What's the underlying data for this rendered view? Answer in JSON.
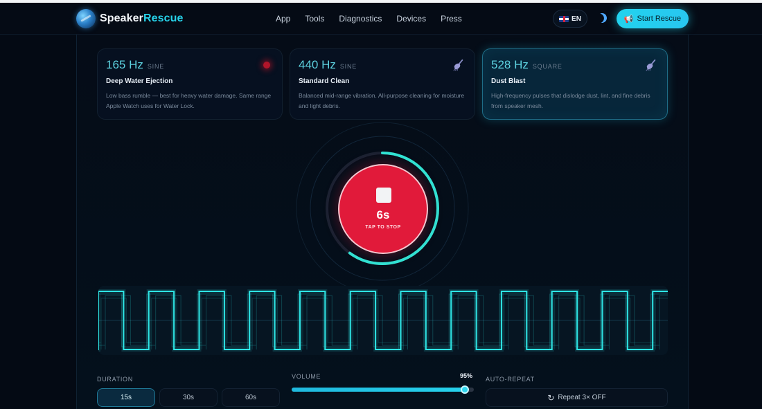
{
  "brand": {
    "name_part1": "Speaker",
    "name_part2": "Rescue"
  },
  "nav": {
    "links": [
      "App",
      "Tools",
      "Diagnostics",
      "Devices",
      "Press"
    ],
    "language": "EN",
    "cta_label": "Start Rescue"
  },
  "modes": [
    {
      "frequency": "165 Hz",
      "wave": "SINE",
      "name": "Deep Water Ejection",
      "description": "Low bass rumble — best for heavy water damage. Same range Apple Watch uses for Water Lock.",
      "icon": "active-dot-icon",
      "selected": false
    },
    {
      "frequency": "440 Hz",
      "wave": "SINE",
      "name": "Standard Clean",
      "description": "Balanced mid-range vibration. All-purpose cleaning for moisture and light debris.",
      "icon": "broom-icon",
      "selected": false
    },
    {
      "frequency": "528 Hz",
      "wave": "SQUARE",
      "name": "Dust Blast",
      "description": "High-frequency pulses that dislodge dust, lint, and fine debris from speaker mesh.",
      "icon": "broom-icon",
      "selected": true
    }
  ],
  "timer": {
    "remaining_label": "6s",
    "action_label": "TAP TO STOP",
    "progress_fraction": 0.6,
    "accent_color": "#2ee6d6",
    "button_color": "#e11a3a"
  },
  "waveform": {
    "type": "square",
    "cycles": 11.3,
    "color": "#2ee6e6"
  },
  "controls": {
    "duration": {
      "label": "DURATION",
      "options": [
        "15s",
        "30s",
        "60s"
      ],
      "selected": "15s"
    },
    "volume": {
      "label": "VOLUME",
      "value_label": "95%",
      "value": 95
    },
    "auto_repeat": {
      "label": "AUTO-REPEAT",
      "button_label": "Repeat 3× OFF"
    }
  }
}
